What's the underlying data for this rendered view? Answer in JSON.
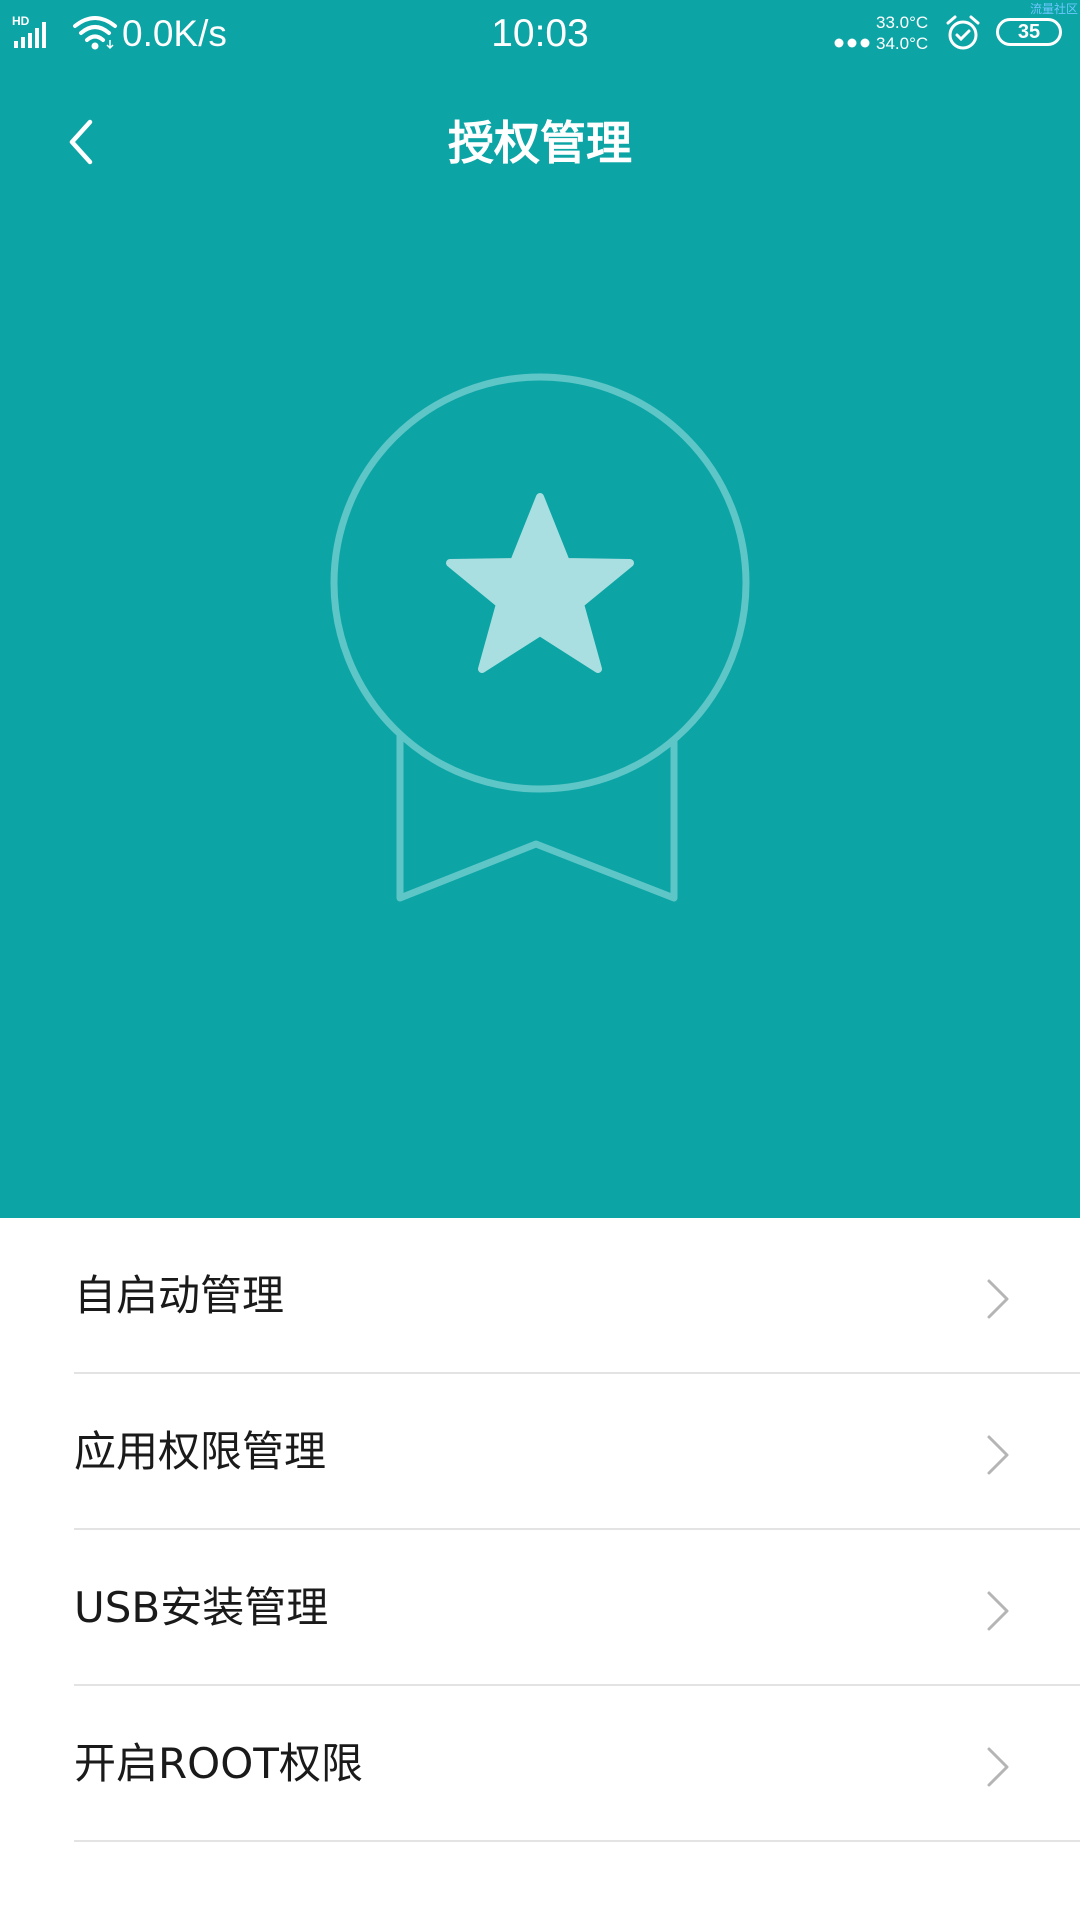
{
  "status_bar": {
    "network_type": "HD",
    "net_speed": "0.0K/s",
    "time": "10:03",
    "temp_1": "33.0°C",
    "temp_2": "34.0°C",
    "battery": "35",
    "watermark": "流量社区"
  },
  "header": {
    "title": "授权管理",
    "back_icon": "chevron-left-icon"
  },
  "hero": {
    "icon": "medal-star-icon"
  },
  "menu": {
    "items": [
      {
        "label": "自启动管理"
      },
      {
        "label": "应用权限管理"
      },
      {
        "label": "USB安装管理"
      },
      {
        "label": "开启ROOT权限"
      }
    ]
  },
  "colors": {
    "accent": "#0ca4a5",
    "medal_outline": "#5ec6c7",
    "medal_star": "#a9dfe0",
    "divider": "#e3e3e3"
  }
}
